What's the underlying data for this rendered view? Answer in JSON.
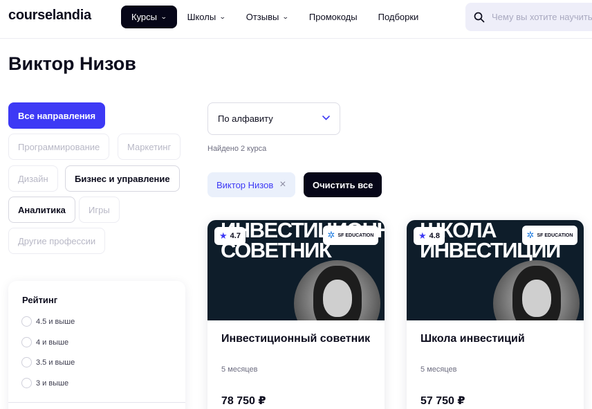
{
  "header": {
    "logo": "courselandia",
    "nav": [
      {
        "label": "Курсы",
        "active": true,
        "has_dropdown": true
      },
      {
        "label": "Школы",
        "active": false,
        "has_dropdown": true
      },
      {
        "label": "Отзывы",
        "active": false,
        "has_dropdown": true
      },
      {
        "label": "Промокоды",
        "active": false,
        "has_dropdown": false
      },
      {
        "label": "Подборки",
        "active": false,
        "has_dropdown": false
      }
    ],
    "search": {
      "placeholder": "Чему вы хотите научиться?",
      "icon": "search-icon"
    }
  },
  "page_title": "Виктор Низов",
  "categories": [
    {
      "label": "Все направления",
      "state": "selected"
    },
    {
      "label": "Программирование",
      "state": "disabled"
    },
    {
      "label": "Маркетинг",
      "state": "disabled"
    },
    {
      "label": "Дизайн",
      "state": "disabled"
    },
    {
      "label": "Бизнес и управление",
      "state": "enabled"
    },
    {
      "label": "Аналитика",
      "state": "enabled"
    },
    {
      "label": "Игры",
      "state": "disabled"
    },
    {
      "label": "Другие профессии",
      "state": "disabled"
    }
  ],
  "rating_filter": {
    "title": "Рейтинг",
    "options": [
      "4.5 и выше",
      "4 и выше",
      "3.5 и выше",
      "3 и выше"
    ]
  },
  "sort": {
    "selected": "По алфавиту",
    "icon": "chevron-down-icon"
  },
  "found_text": "Найдено 2 курса",
  "active_filter": {
    "label": "Виктор Низов",
    "remove_icon": "close-icon"
  },
  "clear_all": "Очистить все",
  "colors": {
    "accent": "#3d39f5",
    "dark": "#060618",
    "chip_bg": "#eaf0fb",
    "card_image_bg": "#0e1d2a"
  },
  "courses": [
    {
      "image_title": "ИНВЕСТИЦИОННЫЙ\nСОВЕТНИК",
      "rating": "4.7",
      "school": "SF EDUCATION",
      "title": "Инвестиционный советник",
      "duration": "5 месяцев",
      "price": "78 750 ₽"
    },
    {
      "image_title": "ШКОЛА\nИНВЕСТИЦИЙ",
      "rating": "4.8",
      "school": "SF EDUCATION",
      "title": "Школа инвестиций",
      "duration": "5 месяцев",
      "price": "57 750 ₽"
    }
  ]
}
